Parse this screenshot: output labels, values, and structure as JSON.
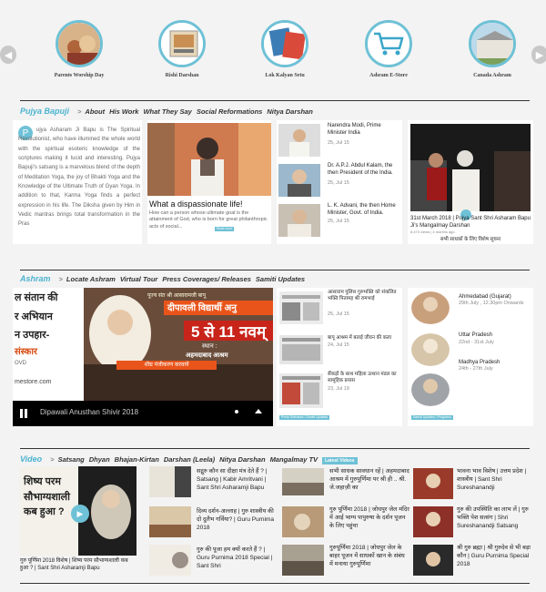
{
  "carousel": {
    "prev_icon": "chevron-left-icon",
    "next_icon": "chevron-right-icon",
    "items": [
      {
        "label": "Parents Worship Day"
      },
      {
        "label": "Rishi Darshan"
      },
      {
        "label": "Lok Kalyan Setu"
      },
      {
        "label": "Ashram E-Store"
      },
      {
        "label": "Canada Ashram"
      }
    ]
  },
  "bapuji": {
    "nav": [
      "Pujya Bapuji",
      ">",
      "About",
      "His Work",
      "What They Say",
      "Social Reformations",
      "Nitya Darshan"
    ],
    "about": {
      "dropcap": "P",
      "text": "ujya Asharam Ji Bapu is The Spiritual Revolutionist, who have illumined the whole world with the spiritual esoteric knowledge of the scriptures making it lucid and interesting. Pujya Bapuji's satsang is a marvelous blend of the depth of Meditation Yoga, the joy of Bhakti Yoga and the Knowledge of the Ultimate Truth of Gyan Yoga. In addition to that, Karma Yoga finds a perfect expression in his life. The Diksha given by Him in Vedic mantras brings total transformation in the Pras"
    },
    "featured": {
      "title": "What a dispassionate life!",
      "excerpt": "How can a person whose ultimate goal is the attainment of God, who is born for great philanthropic acts of social...",
      "tag": "Read more"
    },
    "says": [
      {
        "title": "Narendra Modi, Prime Minister India",
        "date": "25, Jul 15"
      },
      {
        "title": "Dr. A.P.J. Abdul Kalam, the then President of the India.",
        "date": "25, Jul 15"
      },
      {
        "title": "L. K. Advani, the then Home Minister, Govt. of India.",
        "date": "25, Jul 15"
      }
    ],
    "video": {
      "caption": "31st March 2018 | Pujya Sant Shri Asharam Bapu Ji's Mangalmay Darshan",
      "meta": "8,473 views | 4 months ago",
      "hindi": "सभी साधकों के लिए विशेष सूचना"
    }
  },
  "ashram": {
    "nav": [
      "Ashram",
      ">",
      "Locate Ashram",
      "Virtual Tour",
      "Press Coverages/ Releases",
      "Samiti Updates"
    ],
    "player": {
      "left_lines": [
        "ल संतान की",
        "र अभियान",
        "न उपहार-",
        "संस्कार"
      ],
      "left_small": "OVD",
      "left_url": "mestore.com",
      "banner_top": "पूज्य संत श्री आसारामजी बापू",
      "banner_title": "दीपावली विद्यार्थी अनु",
      "dates": "5 से 11 नवम्",
      "place_label": "स्थान :",
      "place": "अहमदाबाद आश्रम",
      "reg": "शीघ्र पंजीकरण करवायें",
      "title": "Dipawali Anusthan Shivir 2018"
    },
    "press": [
      {
        "title": "आसाराम पुलिस गुरुभक्ति को संकलित भक्ति पितामह श्री रामभाई",
        "date": "25, Jul 15"
      },
      {
        "title": "बापू आश्रम में बताई जीवन की कला",
        "date": "24, Jul 15"
      },
      {
        "title": "सैंकड़ों के साथ महिला उत्थान मंडल का सामूहिक प्रयास",
        "date": "23, Jul 19"
      }
    ],
    "press_tag": "Press Releases / Samiti Updates",
    "events": [
      {
        "place": "Ahmedabad (Gujarat)",
        "date": "29th July , 12.30pm Onwards"
      },
      {
        "place": "Uttar Pradesh",
        "date": "22nd - 31st July"
      },
      {
        "place": "Madhya Pradesh",
        "date": "24th - 27th July"
      }
    ],
    "events_tag": "Samiti Updates / Programs"
  },
  "videos": {
    "nav": [
      "Video",
      ">",
      "Satsang",
      "Dhyan",
      "Bhajan-Kirtan",
      "Darshan (Leela)",
      "Nitya Darshan",
      "Mangalmay TV"
    ],
    "badge": "Latest Videos",
    "feature": {
      "overlay": [
        "शिष्य परम",
        "सौभाग्यशाली",
        "कब हुआ ?"
      ],
      "title": "गुरु पूर्णिमा 2018 विशेष | शिष्य परम सौभाग्यशाली कब हुआ ? | Sant Shri Asharamji Bapu"
    },
    "col1": [
      "सद्गुरु कौन सा दीक्षा मंत्र देते हैं ? | Satsang | Kabir Amritvani | Sant Shri Asharamji Bapu",
      "दिव्य दर्शन-अल्लाह | गुरु शास्त्रीय की दो दुलैभ गर्विया? | Guru Purnima 2018",
      "गुरु की पूजा हम क्यों करते हैं ? | Guru Purnima 2018 Special | Sant Shri"
    ],
    "col2": [
      "सभी साधक सावधान रहें | अहमदाबाद आश्रम में गुरुपूर्णिमा पर श्री ही .. श्री. जे.जहाज़ी का",
      "गुरु पूर्णिमा 2018 | जोधपुर जेल मंदिर में आई भाग्य पापुरुषा के दर्शन पूजन के लिए पहुंचा",
      "गुरुपूर्णिमा 2018 | जोधपुर जेल के बाहर पूजन में साधकों खान के संबंध में मनाया गुरुपूर्णिमा"
    ],
    "col3": [
      "भावना भाव विशेष | उत्तम प्रदेश | शास्त्रीय | Sant Shri Sureshanandji",
      "गुरु की उपस्थिति का लाभ लें | गुरु भक्ति पेश सत्संग | Shri Sureshanandji Satsang",
      "श्री गुरु ब्रह्मा | श्री गुरुदेव से भी बड़ा कौन | Guru Purnima Special 2018"
    ]
  },
  "colors": {
    "accent": "#6ec1d6",
    "background": "#f3f3f3"
  }
}
